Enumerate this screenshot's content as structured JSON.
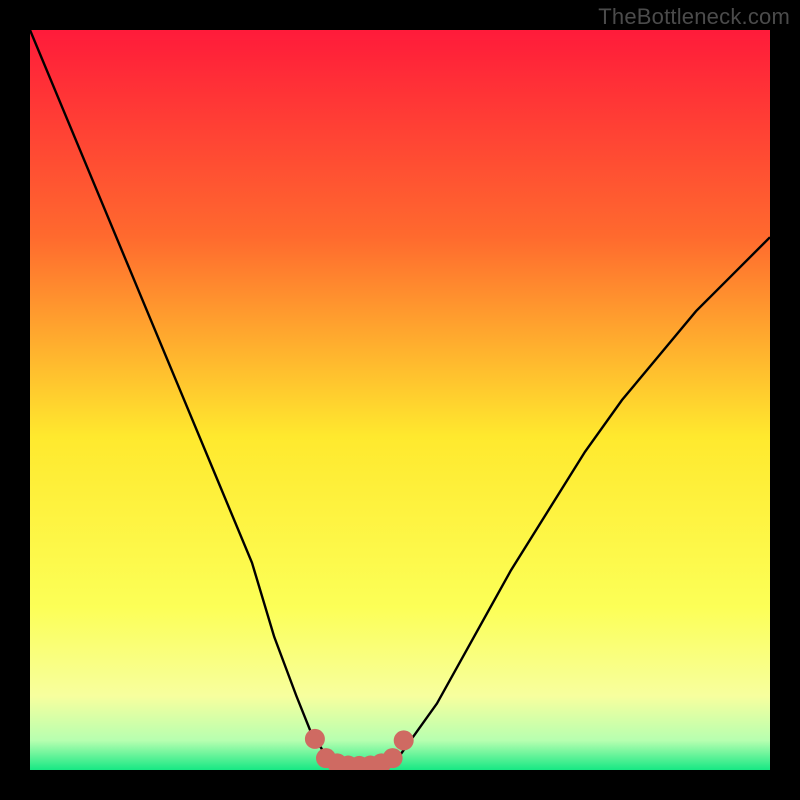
{
  "watermark": "TheBottleneck.com",
  "chart_data": {
    "type": "line",
    "title": "",
    "xlabel": "",
    "ylabel": "",
    "xlim": [
      0,
      100
    ],
    "ylim": [
      0,
      100
    ],
    "series": [
      {
        "name": "bottleneck-curve",
        "x": [
          0,
          5,
          10,
          15,
          20,
          25,
          30,
          33,
          36,
          38,
          40,
          42,
          44,
          46,
          48,
          50,
          55,
          60,
          65,
          70,
          75,
          80,
          85,
          90,
          95,
          100
        ],
        "y": [
          100,
          88,
          76,
          64,
          52,
          40,
          28,
          18,
          10,
          5,
          2,
          0.8,
          0.5,
          0.5,
          0.8,
          2,
          9,
          18,
          27,
          35,
          43,
          50,
          56,
          62,
          67,
          72
        ]
      }
    ],
    "markers": {
      "name": "highlight-points",
      "x": [
        38.5,
        40,
        41.5,
        43,
        44.5,
        46,
        47.5,
        49,
        50.5
      ],
      "y": [
        4.2,
        1.6,
        0.9,
        0.6,
        0.55,
        0.6,
        0.9,
        1.6,
        4.0
      ]
    },
    "colors": {
      "curve": "#000000",
      "marker": "#cf6a62",
      "gradient_top": "#ff1b3a",
      "gradient_mid1": "#ff8a2a",
      "gradient_mid2": "#ffe92e",
      "gradient_low": "#f7ff9e",
      "gradient_bottom": "#17e884"
    }
  }
}
